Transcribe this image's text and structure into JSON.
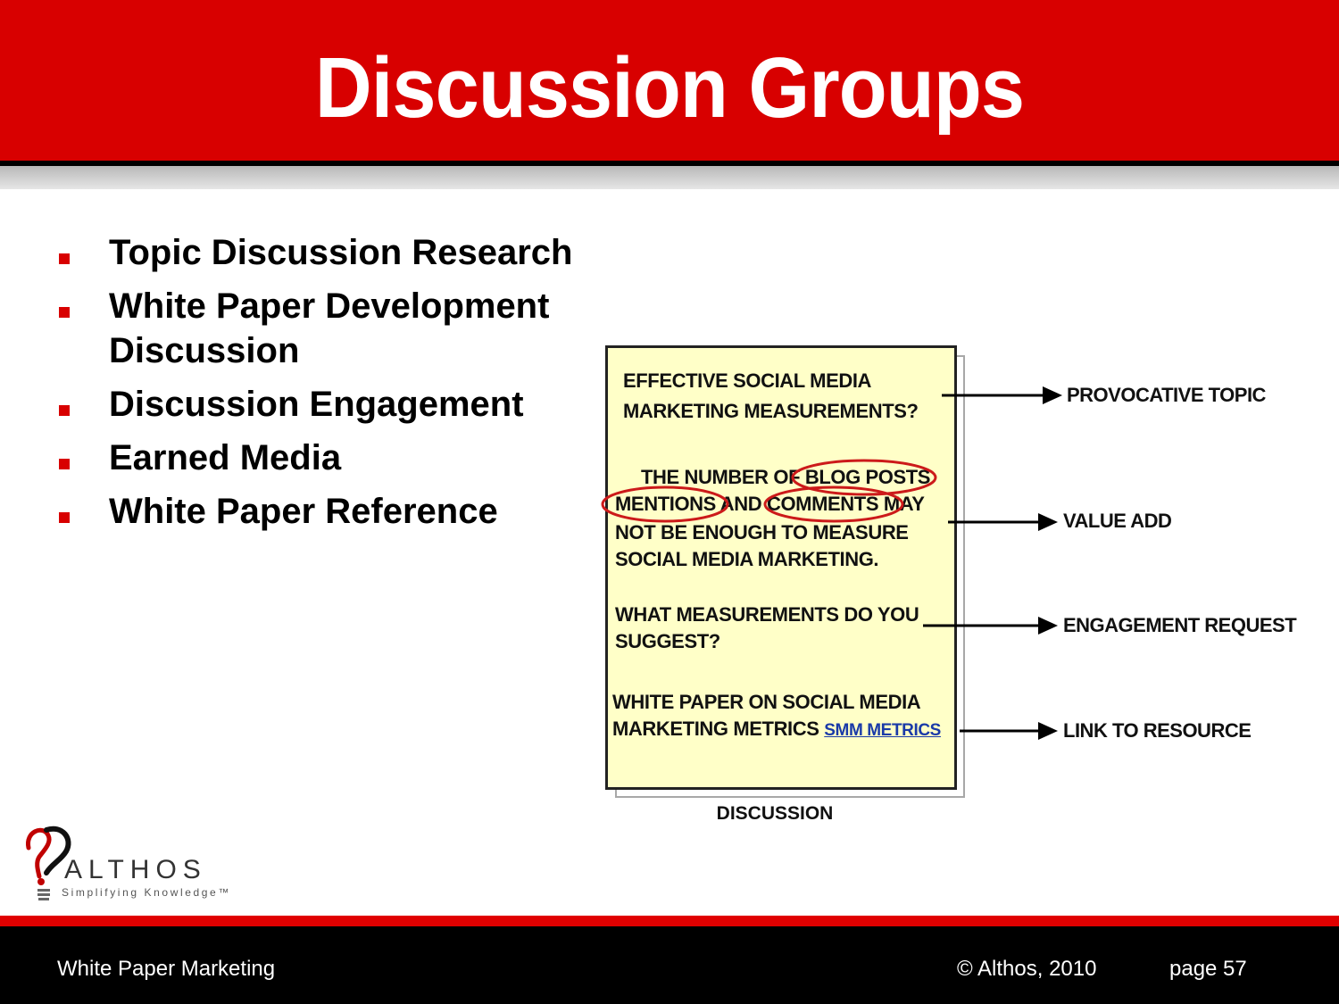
{
  "slide": {
    "title": "Discussion Groups",
    "bullets": [
      "Topic Discussion Research",
      "White Paper Development Discussion",
      "Discussion Engagement",
      "Earned Media",
      "White Paper Reference"
    ]
  },
  "illustration": {
    "doc_lines": {
      "line1": "EFFECTIVE SOCIAL MEDIA",
      "line2": "MARKETING MEASUREMENTS?",
      "line3": "THE NUMBER OF BLOG POSTS",
      "line4": "MENTIONS AND COMMENTS MAY",
      "line5": "NOT BE ENOUGH TO MEASURE",
      "line6": "SOCIAL MEDIA MARKETING.",
      "line7": "WHAT MEASUREMENTS DO YOU",
      "line8": "SUGGEST?",
      "line9": "WHITE PAPER ON SOCIAL MEDIA",
      "line10": "MARKETING METRICS",
      "link": "SMM METRICS"
    },
    "callouts": {
      "c1": "PROVOCATIVE TOPIC",
      "c2": "VALUE ADD",
      "c3": "ENGAGEMENT REQUEST",
      "c4": "LINK TO RESOURCE"
    },
    "caption": "DISCUSSION"
  },
  "logo": {
    "name": "ALTHOS",
    "tagline": "Simplifying Knowledge™",
    "icon": "lightbulb-question-icon"
  },
  "footer": {
    "left": "White Paper Marketing",
    "center": "© Althos,  2010",
    "right": "page 57"
  },
  "colors": {
    "accent": "#d80000",
    "doc_background": "#ffffc8",
    "link": "#1a3aa8"
  }
}
